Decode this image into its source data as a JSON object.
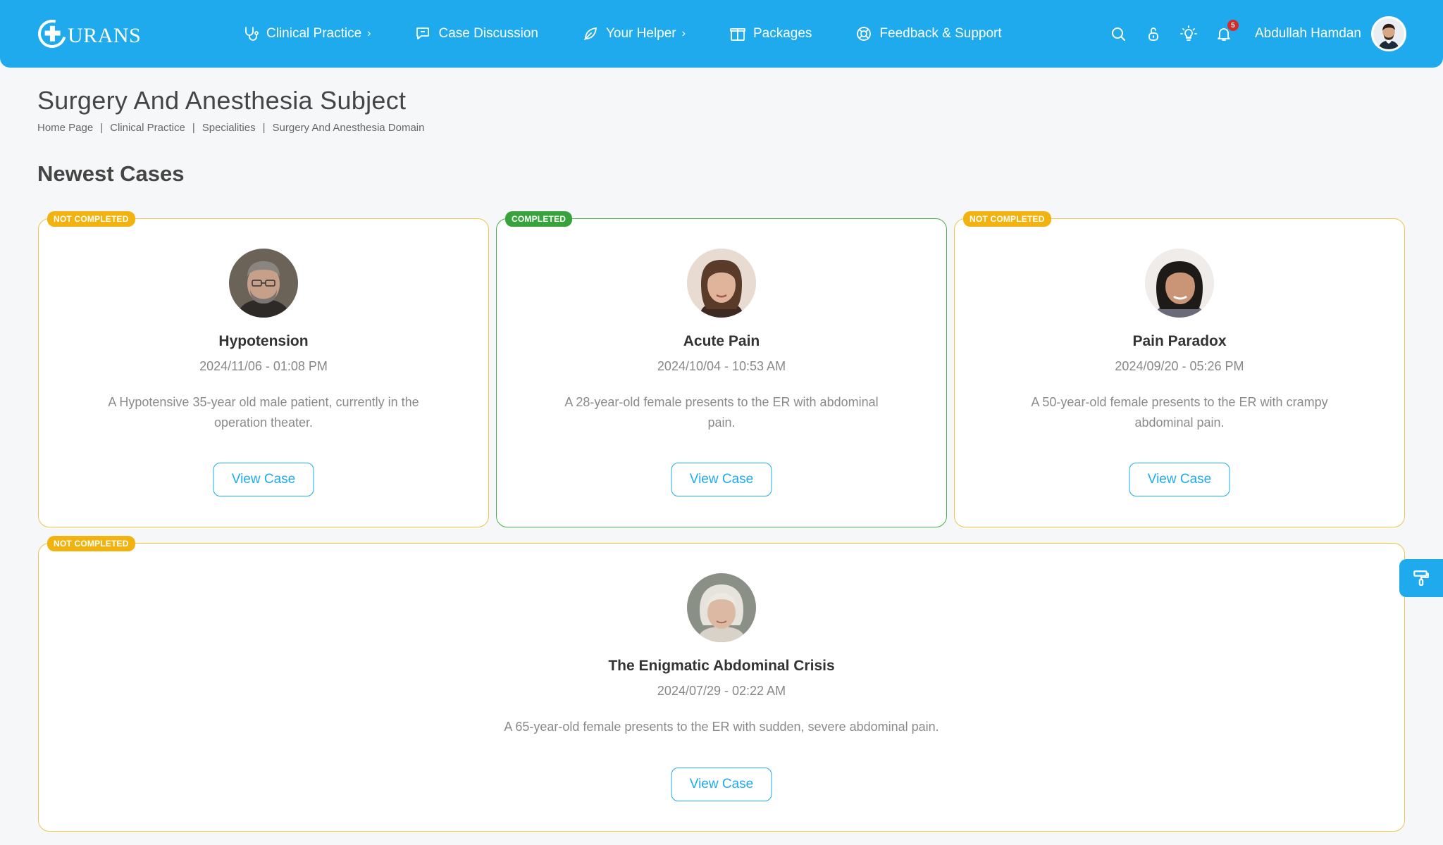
{
  "brand": {
    "logo_text": "URANS"
  },
  "nav": {
    "items": [
      {
        "label": "Clinical Practice",
        "icon": "stethoscope-icon",
        "has_chevron": true
      },
      {
        "label": "Case Discussion",
        "icon": "chat-icon",
        "has_chevron": false
      },
      {
        "label": "Your Helper",
        "icon": "leaf-icon",
        "has_chevron": true
      },
      {
        "label": "Packages",
        "icon": "package-icon",
        "has_chevron": false
      },
      {
        "label": "Feedback & Support",
        "icon": "lifebuoy-icon",
        "has_chevron": false
      }
    ],
    "chevron": "›",
    "notification_count": "5",
    "user_name": "Abdullah Hamdan"
  },
  "page": {
    "title": "Surgery And Anesthesia Subject",
    "breadcrumb": [
      "Home Page",
      "Clinical Practice",
      "Specialities",
      "Surgery And Anesthesia Domain"
    ],
    "breadcrumb_sep": "|",
    "section_title": "Newest Cases"
  },
  "cases": [
    {
      "status": "NOT COMPLETED",
      "title": "Hypotension",
      "date": "2024/11/06 - 01:08 PM",
      "description": "A Hypotensive 35-year old male patient, currently in the operation theater.",
      "button": "View Case"
    },
    {
      "status": "COMPLETED",
      "title": "Acute Pain",
      "date": "2024/10/04 - 10:53 AM",
      "description": "A 28-year-old female presents to the ER with abdominal pain.",
      "button": "View Case"
    },
    {
      "status": "NOT COMPLETED",
      "title": "Pain Paradox",
      "date": "2024/09/20 - 05:26 PM",
      "description": "A 50-year-old female presents to the ER with crampy abdominal pain.",
      "button": "View Case"
    },
    {
      "status": "NOT COMPLETED",
      "title": "The Enigmatic Abdominal Crisis",
      "date": "2024/07/29 - 02:22 AM",
      "description": "A 65-year-old female presents to the ER with sudden, severe abdominal pain.",
      "button": "View Case"
    }
  ],
  "colors": {
    "primary": "#1eaaec",
    "not_completed": "#f2b311",
    "completed": "#38a33c"
  }
}
